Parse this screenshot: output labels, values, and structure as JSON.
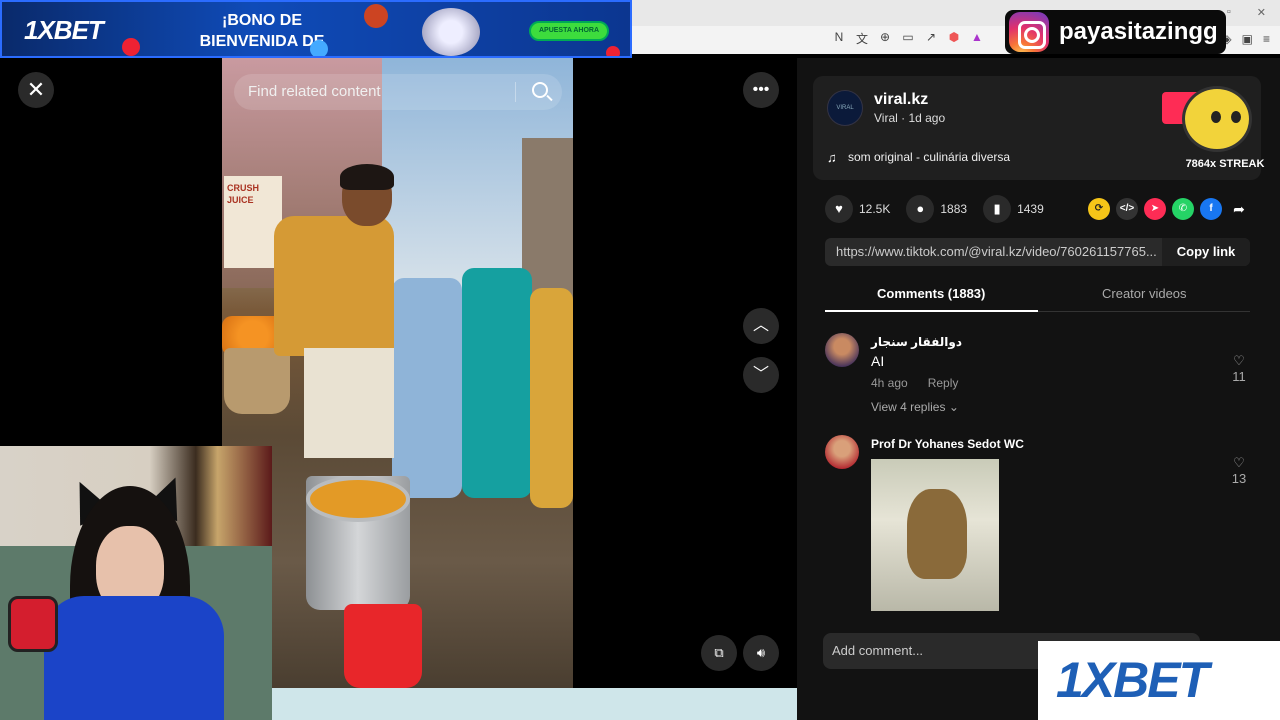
{
  "top_ad": {
    "logo": "1XBET",
    "headline": "¡BONO DE BIENVENIDA DE HASTA",
    "cta": "APUESTA AHORA"
  },
  "instagram": {
    "icon": "instagram-icon",
    "handle": "payasitazingg"
  },
  "video": {
    "search_placeholder": "Find related content"
  },
  "post": {
    "account_name": "viral.kz",
    "subtitle": "Viral · 1d ago",
    "music": "som original - culinária diversa",
    "follow_label": "F"
  },
  "overlay": {
    "streak": "7864x STREAK"
  },
  "stats": {
    "likes": "12.5K",
    "comments": "1883",
    "saves": "1439"
  },
  "share": {
    "url": "https://www.tiktok.com/@viral.kz/video/760261157765...",
    "copy_label": "Copy link"
  },
  "tabs": {
    "comments": "Comments (1883)",
    "creator": "Creator videos"
  },
  "comments": [
    {
      "author": "دوالفقار سنجار",
      "text": "AI",
      "time": "4h ago",
      "reply": "Reply",
      "view_replies": "View 4 replies",
      "likes": "11"
    },
    {
      "author": "Prof Dr Yohanes Sedot WC",
      "likes": "13"
    }
  ],
  "add_comment_placeholder": "Add comment...",
  "bottom_ad": {
    "logo": "1XBET"
  },
  "colors": {
    "panel_bg": "#121212",
    "follow_red": "#fe2c55",
    "brand_blue": "#1e5fb6"
  }
}
